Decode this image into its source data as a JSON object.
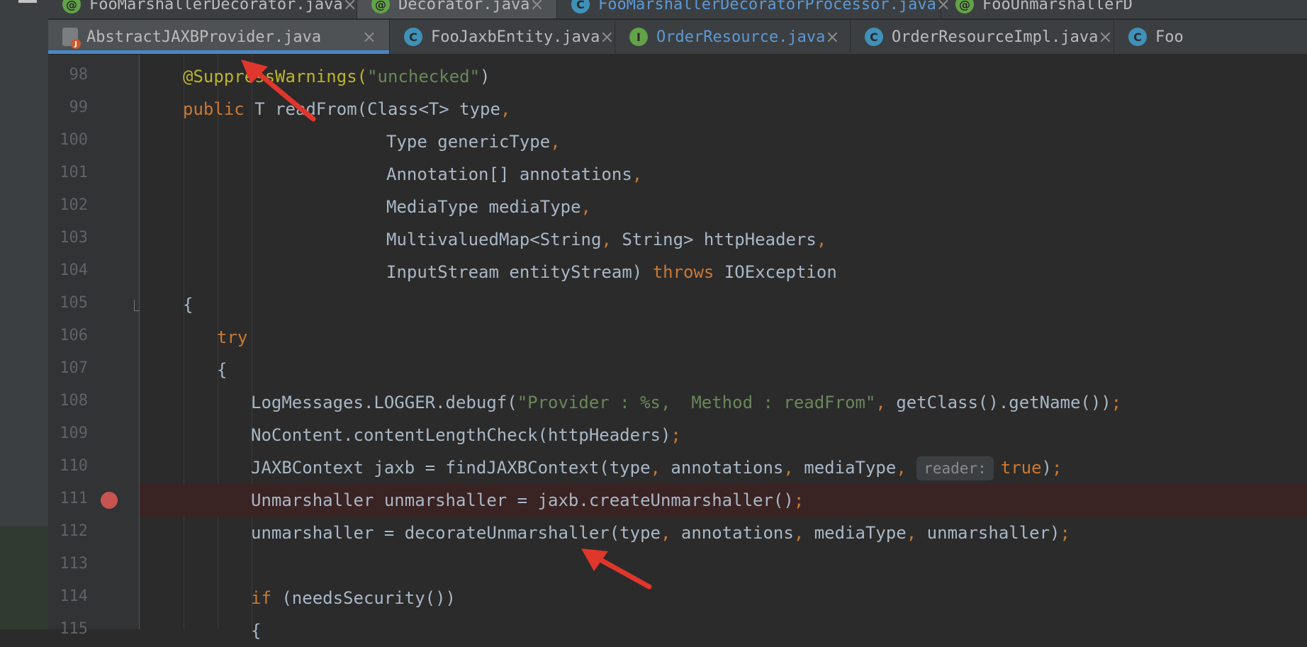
{
  "window": {
    "menu_icon": "hamburger-icon"
  },
  "tabs_row1": [
    {
      "icon": "at",
      "label": "FooMarshallerDecorator.java"
    },
    {
      "icon": "at",
      "label": "Decorator.java"
    },
    {
      "icon": "c",
      "label": "FooMarshallerDecoratorProcessor.java"
    },
    {
      "icon": "at",
      "label": "FooUnmarshallerD"
    }
  ],
  "tabs_row2": [
    {
      "icon": "j",
      "label": "AbstractJAXBProvider.java"
    },
    {
      "icon": "c",
      "label": "FooJaxbEntity.java"
    },
    {
      "icon": "i",
      "label": "OrderResource.java"
    },
    {
      "icon": "c",
      "label": "OrderResourceImpl.java"
    },
    {
      "icon": "c",
      "label": "Foo"
    }
  ],
  "close_glyph": "×",
  "editor": {
    "line_numbers": [
      "98",
      "99",
      "100",
      "101",
      "102",
      "103",
      "104",
      "105",
      "106",
      "107",
      "108",
      "109",
      "110",
      "111",
      "112",
      "113",
      "114",
      "115"
    ],
    "breakpoint_line": "111",
    "inlay_hint": "reader:",
    "code": {
      "l98_ann": "@SuppressWarnings(",
      "l98_str": "\"unchecked\"",
      "l98_end": ")",
      "l99_kw": "public",
      "l99_rest": " T readFrom(Class<T> type",
      "l100": "Type genericType",
      "l101": "Annotation[] annotations",
      "l102": "MediaType mediaType",
      "l103a": "MultivaluedMap<String",
      "l103b": " String> httpHeaders",
      "l104a": "InputStream entityStream) ",
      "l104_kw": "throws",
      "l104b": " IOException",
      "l105": "{",
      "l106_kw": "try",
      "l107": "{",
      "l108a": "LogMessages.LOGGER.debugf(",
      "l108_str": "\"Provider : %s,  Method : readFrom\"",
      "l108b": " getClass().getName())",
      "l109": "NoContent.contentLengthCheck(httpHeaders)",
      "l110a": "JAXBContext jaxb = findJAXBContext(type",
      "l110b": " annotations",
      "l110c": " mediaType",
      "l110_kw": "true",
      "l110d": ")",
      "l111": "Unmarshaller unmarshaller = jaxb.createUnmarshaller()",
      "l112a": "unmarshaller = decorateUnmarshaller(type",
      "l112b": " annotations",
      "l112c": " mediaType",
      "l112d": " unmarshaller)",
      "l114_kw": "if",
      "l114": " (needsSecurity())",
      "l115": "{"
    }
  },
  "colors": {
    "keyword": "#cc7832",
    "string": "#6a8759",
    "annotation": "#bbb529",
    "text": "#a9b7c6",
    "arrow": "#e0362b",
    "breakpoint": "#c75450"
  }
}
